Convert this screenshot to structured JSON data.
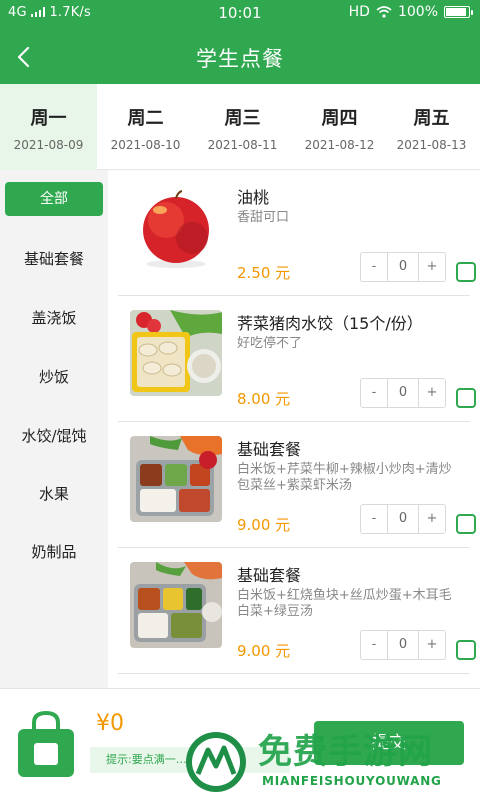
{
  "status": {
    "network": "4G",
    "speed": "1.7K/s",
    "time": "10:01",
    "hd": "HD",
    "battery": "100%",
    "battery_level": 1.0
  },
  "header": {
    "title": "学生点餐"
  },
  "week": [
    {
      "day": "周一",
      "date": "2021-08-09",
      "active": true
    },
    {
      "day": "周二",
      "date": "2021-08-10",
      "active": false
    },
    {
      "day": "周三",
      "date": "2021-08-11",
      "active": false
    },
    {
      "day": "周四",
      "date": "2021-08-12",
      "active": false
    },
    {
      "day": "周五",
      "date": "2021-08-13",
      "active": false
    }
  ],
  "categories": [
    {
      "label": "全部",
      "active": true
    },
    {
      "label": "基础套餐",
      "active": false
    },
    {
      "label": "盖浇饭",
      "active": false
    },
    {
      "label": "炒饭",
      "active": false
    },
    {
      "label": "水饺/馄饨",
      "active": false
    },
    {
      "label": "水果",
      "active": false
    },
    {
      "label": "奶制品",
      "active": false
    }
  ],
  "items": [
    {
      "name": "油桃",
      "desc": "香甜可口",
      "price": "2.50 元",
      "qty": "0",
      "minus": "-",
      "plus": "+"
    },
    {
      "name": "荠菜猪肉水饺（15个/份）",
      "desc": "好吃停不了",
      "price": "8.00 元",
      "qty": "0",
      "minus": "-",
      "plus": "+"
    },
    {
      "name": "基础套餐",
      "desc": "白米饭+芹菜牛柳+辣椒小炒肉+清炒包菜丝+紫菜虾米汤",
      "price": "9.00 元",
      "qty": "0",
      "minus": "-",
      "plus": "+"
    },
    {
      "name": "基础套餐",
      "desc": "白米饭+红烧鱼块+丝瓜炒蛋+木耳毛白菜+绿豆汤",
      "price": "9.00 元",
      "qty": "0",
      "minus": "-",
      "plus": "+"
    }
  ],
  "cart": {
    "total": "¥0",
    "hint": "提示:要点满一……哦",
    "submit": "提交"
  },
  "watermark": {
    "cn": "免费手游网",
    "en": "MIANFEISHOUYOUWANG"
  },
  "colors": {
    "brand_green": "#2fa84f",
    "price_orange": "#f39800"
  }
}
